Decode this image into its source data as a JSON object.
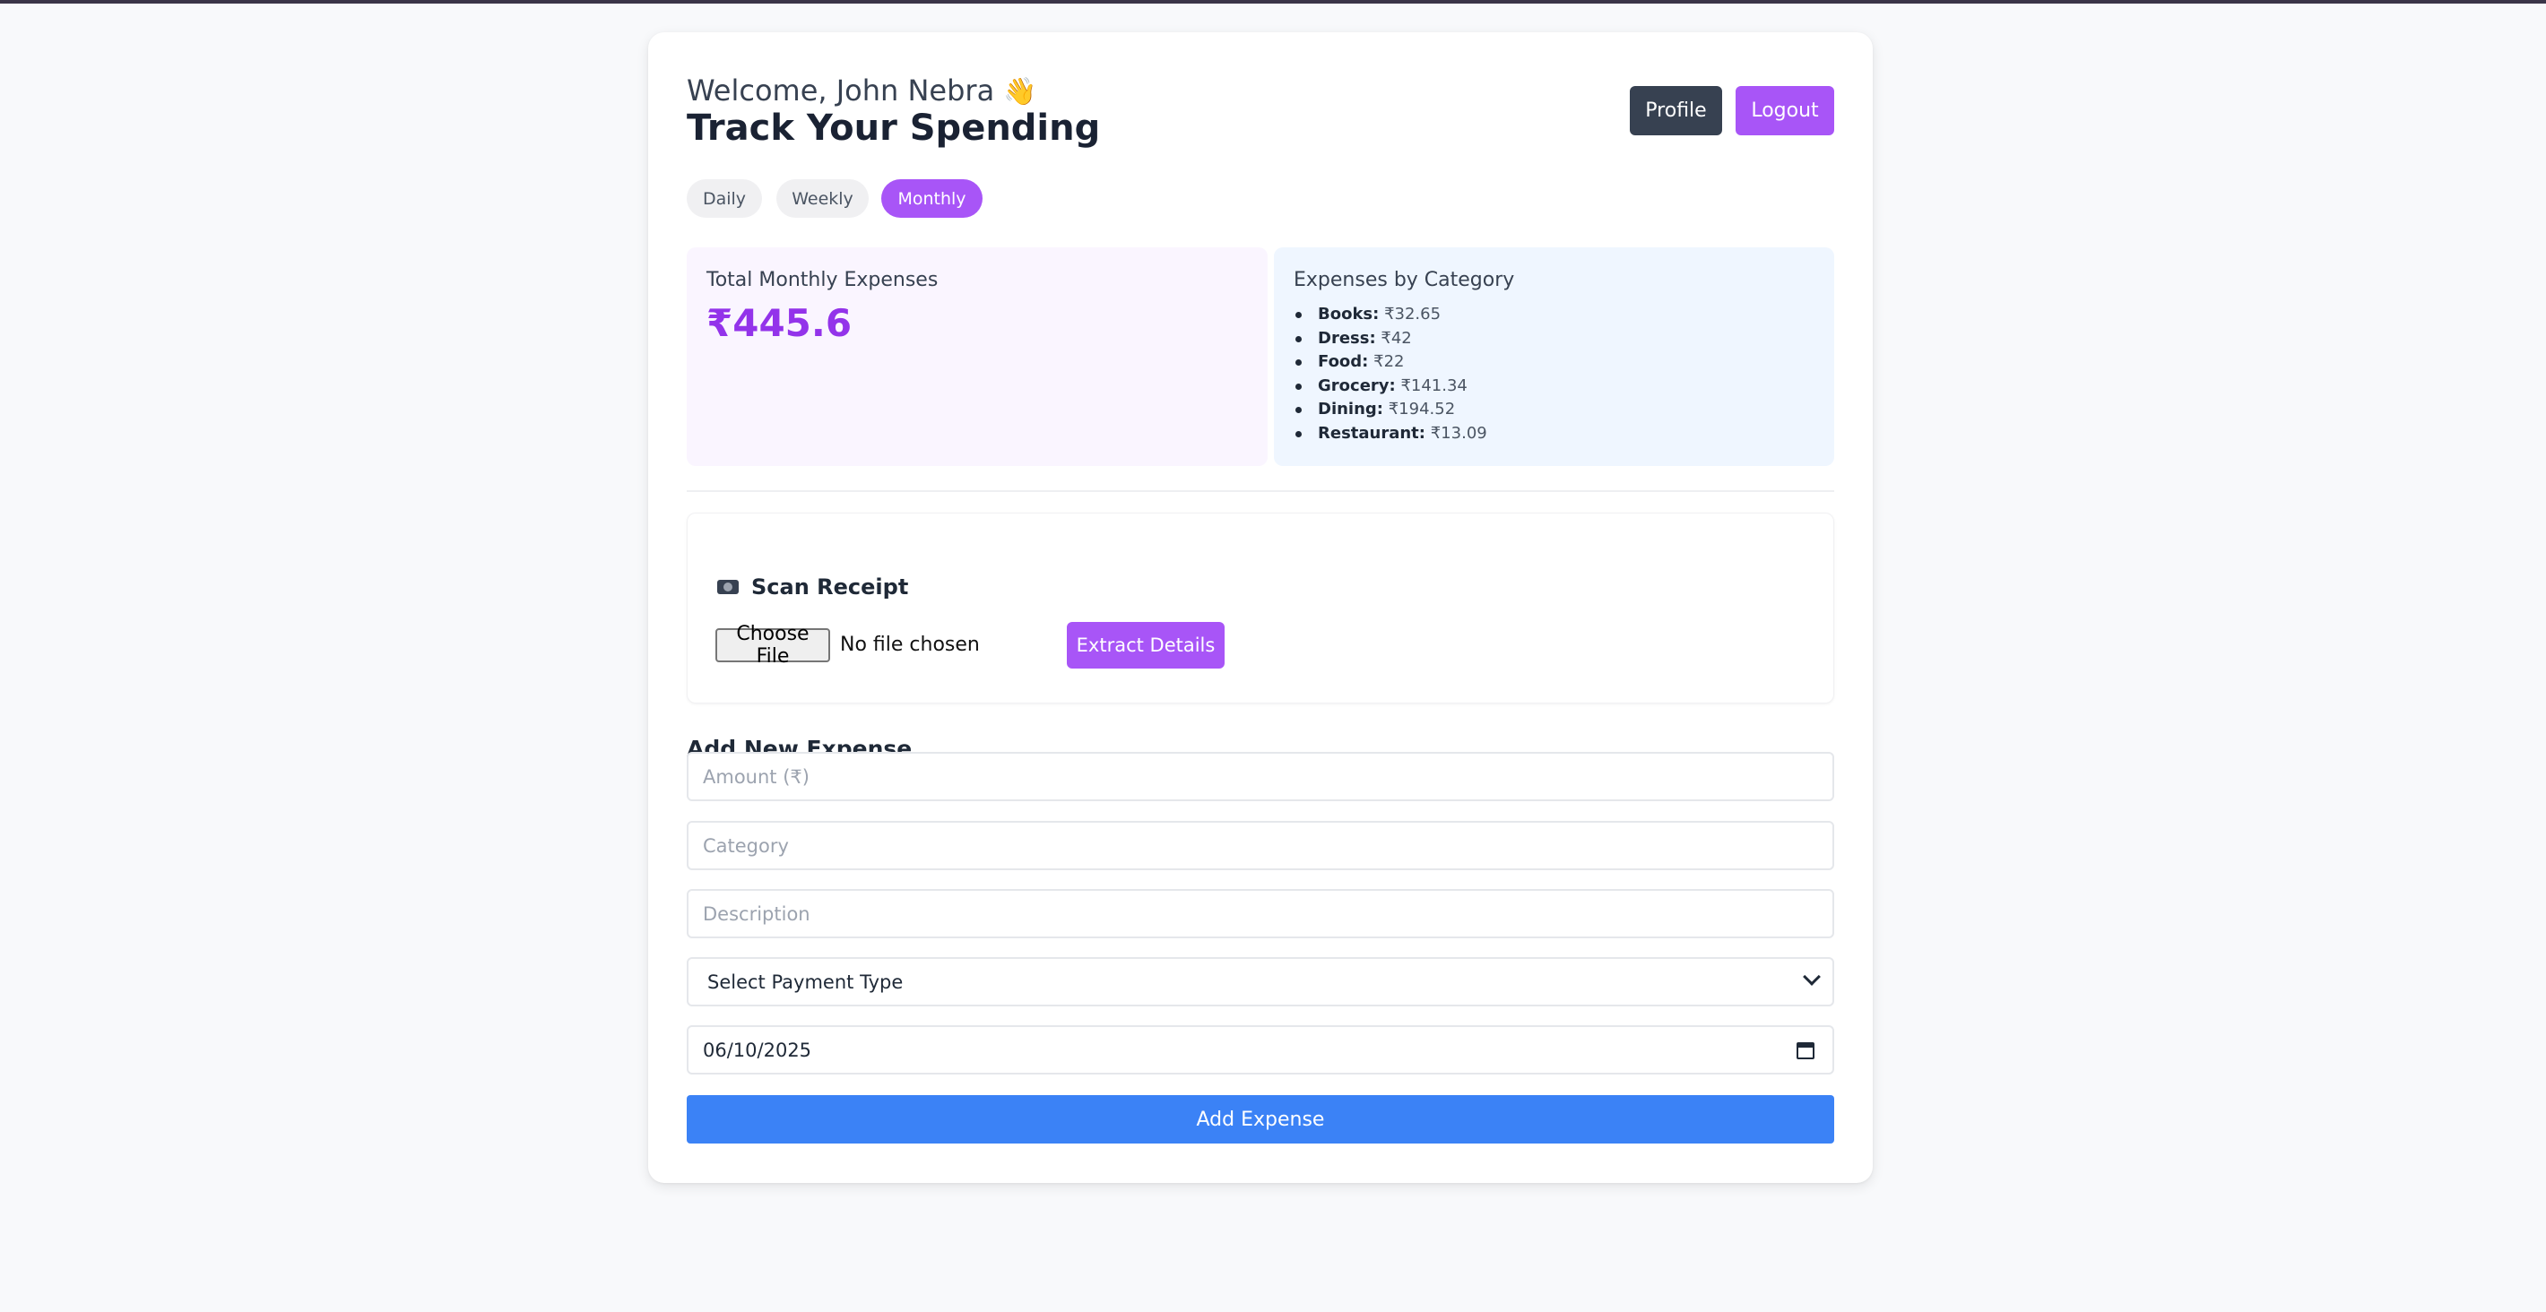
{
  "header": {
    "welcome": "Welcome, John Nebra",
    "wave_icon": "👋",
    "title": "Track Your Spending",
    "profile_label": "Profile",
    "logout_label": "Logout"
  },
  "tabs": [
    {
      "label": "Daily",
      "active": false
    },
    {
      "label": "Weekly",
      "active": false
    },
    {
      "label": "Monthly",
      "active": true
    }
  ],
  "summary": {
    "total_label": "Total Monthly Expenses",
    "total_value": "₹445.6"
  },
  "categories": {
    "label": "Expenses by Category",
    "items": [
      {
        "name": "Books:",
        "amount": "₹32.65"
      },
      {
        "name": "Dress:",
        "amount": "₹42"
      },
      {
        "name": "Food:",
        "amount": "₹22"
      },
      {
        "name": "Grocery:",
        "amount": "₹141.34"
      },
      {
        "name": "Dining:",
        "amount": "₹194.52"
      },
      {
        "name": "Restaurant:",
        "amount": "₹13.09"
      }
    ]
  },
  "scan": {
    "icon": "camera-icon",
    "title": "Scan Receipt",
    "choose_file": "Choose File",
    "no_file": "No file chosen",
    "extract_label": "Extract Details"
  },
  "form": {
    "title": "Add New Expense",
    "amount_placeholder": "Amount (₹)",
    "category_placeholder": "Category",
    "description_placeholder": "Description",
    "payment_selected": "Select Payment Type",
    "date_value": "06/10/2025",
    "submit_label": "Add Expense"
  },
  "colors": {
    "accent": "#a855f7",
    "total_text": "#9333ea",
    "submit": "#3b82f6",
    "profile_btn": "#374151"
  }
}
